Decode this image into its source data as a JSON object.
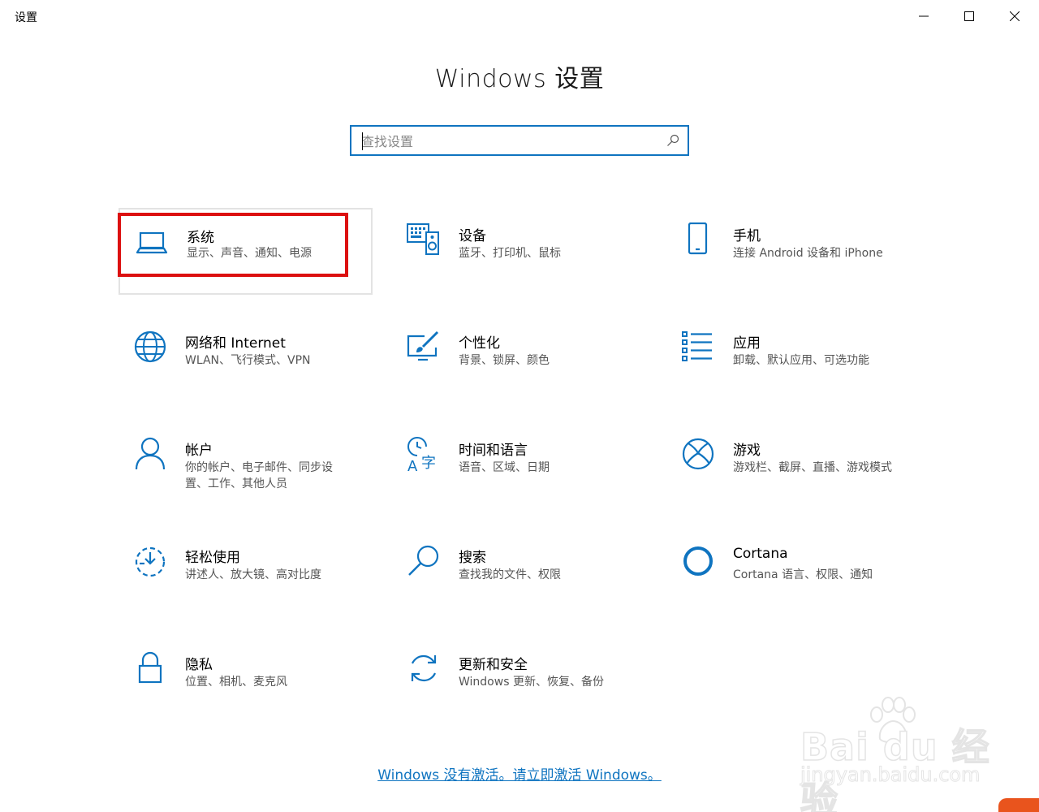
{
  "window": {
    "title": "设置"
  },
  "header": {
    "title": "Windows 设置"
  },
  "search": {
    "placeholder": "查找设置"
  },
  "tiles": [
    {
      "title": "系统",
      "desc": "显示、声音、通知、电源",
      "icon": "laptop-icon"
    },
    {
      "title": "设备",
      "desc": "蓝牙、打印机、鼠标",
      "icon": "devices-icon"
    },
    {
      "title": "手机",
      "desc": "连接 Android 设备和 iPhone",
      "icon": "phone-icon"
    },
    {
      "title": "网络和 Internet",
      "desc": "WLAN、飞行模式、VPN",
      "icon": "globe-icon"
    },
    {
      "title": "个性化",
      "desc": "背景、锁屏、颜色",
      "icon": "personalization-icon"
    },
    {
      "title": "应用",
      "desc": "卸载、默认应用、可选功能",
      "icon": "apps-list-icon"
    },
    {
      "title": "帐户",
      "desc": "你的帐户、电子邮件、同步设置、工作、其他人员",
      "icon": "person-icon"
    },
    {
      "title": "时间和语言",
      "desc": "语音、区域、日期",
      "icon": "time-language-icon"
    },
    {
      "title": "游戏",
      "desc": "游戏栏、截屏、直播、游戏模式",
      "icon": "xbox-icon"
    },
    {
      "title": "轻松使用",
      "desc": "讲述人、放大镜、高对比度",
      "icon": "ease-of-access-icon"
    },
    {
      "title": "搜索",
      "desc": "查找我的文件、权限",
      "icon": "search-magnifier-icon"
    },
    {
      "title": "Cortana",
      "desc": "Cortana 语言、权限、通知",
      "icon": "cortana-circle-icon"
    },
    {
      "title": "隐私",
      "desc": "位置、相机、麦克风",
      "icon": "lock-icon"
    },
    {
      "title": "更新和安全",
      "desc": "Windows 更新、恢复、备份",
      "icon": "update-arrows-icon"
    }
  ],
  "footer": {
    "activate_link": "Windows 没有激活。请立即激活 Windows。"
  },
  "watermark": {
    "line1": "Bai du 经验",
    "line2": "jingyan.baidu.com"
  },
  "colors": {
    "accent": "#0f74c0",
    "highlight": "#dc1010",
    "tile_hover_border": "#e3e3e3"
  }
}
